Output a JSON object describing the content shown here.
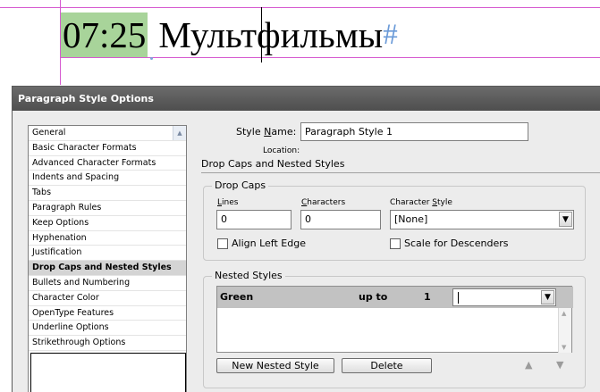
{
  "document": {
    "time_text": "07:25",
    "heading_text": "Мультфильмы",
    "paragraph_mark": "#"
  },
  "dialog": {
    "title": "Paragraph Style Options",
    "categories": [
      {
        "label": "General"
      },
      {
        "label": "Basic Character Formats"
      },
      {
        "label": "Advanced Character Formats"
      },
      {
        "label": "Indents and Spacing"
      },
      {
        "label": "Tabs"
      },
      {
        "label": "Paragraph Rules"
      },
      {
        "label": "Keep Options"
      },
      {
        "label": "Hyphenation"
      },
      {
        "label": "Justification"
      },
      {
        "label": "Drop Caps and Nested Styles",
        "selected": true
      },
      {
        "label": "Bullets and Numbering"
      },
      {
        "label": "Character Color"
      },
      {
        "label": "OpenType Features"
      },
      {
        "label": "Underline Options"
      },
      {
        "label": "Strikethrough Options"
      }
    ],
    "style_name_label_pre": "Style ",
    "style_name_label_ul": "N",
    "style_name_label_post": "ame:",
    "style_name_value": "Paragraph Style 1",
    "location_label": "Location:",
    "section_title": "Drop Caps and Nested Styles",
    "drop_caps": {
      "group_title": "Drop Caps",
      "lines_label_ul": "L",
      "lines_label_rest": "ines",
      "lines_value": "0",
      "characters_label_ul": "C",
      "characters_label_rest": "haracters",
      "characters_value": "0",
      "char_style_label_pre": "Character ",
      "char_style_label_ul": "S",
      "char_style_label_post": "tyle",
      "char_style_value": "[None]",
      "align_left_edge": "Align Left Edge",
      "scale_for_descenders": "Scale for Descenders"
    },
    "nested_styles": {
      "group_title": "Nested Styles",
      "rows": [
        {
          "style": "Green",
          "mode": "up to",
          "count": "1",
          "delimiter": ""
        }
      ],
      "new_button": "New Nested Style",
      "delete_button": "Delete"
    }
  }
}
